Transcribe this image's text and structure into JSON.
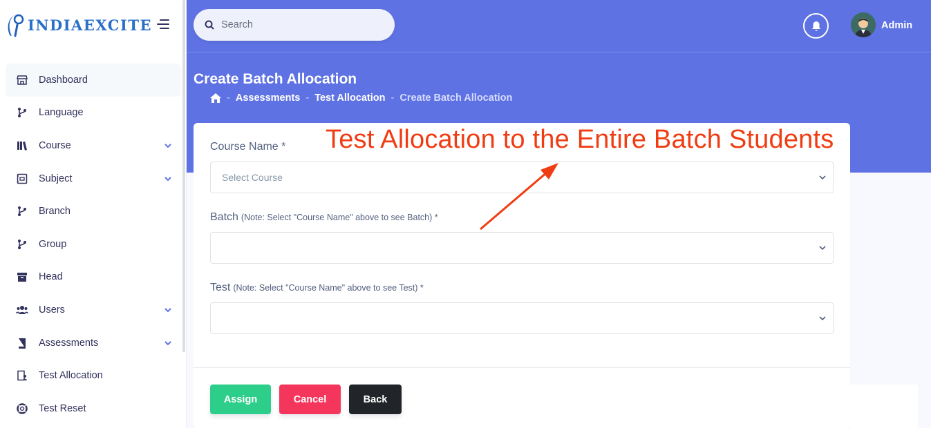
{
  "brand": {
    "name": "INDIAEXCITE",
    "color": "#2a6fc9"
  },
  "colors": {
    "header": "#5e72e4",
    "assign": "#2dce89",
    "cancel": "#f5365c",
    "back": "#212529",
    "annotation": "#f03c13"
  },
  "sidebar": {
    "items": [
      {
        "label": "Dashboard",
        "icon": "shop-icon",
        "active": true
      },
      {
        "label": "Language",
        "icon": "branch-icon"
      },
      {
        "label": "Course",
        "icon": "library-icon",
        "expandable": true
      },
      {
        "label": "Subject",
        "icon": "list-box-icon",
        "expandable": true
      },
      {
        "label": "Branch",
        "icon": "branch-icon"
      },
      {
        "label": "Group",
        "icon": "branch-icon"
      },
      {
        "label": "Head",
        "icon": "box-icon"
      },
      {
        "label": "Users",
        "icon": "users-icon",
        "expandable": true
      },
      {
        "label": "Assessments",
        "icon": "book-icon",
        "expandable": true
      },
      {
        "label": "Test Allocation",
        "icon": "assign-icon"
      },
      {
        "label": "Test Reset",
        "icon": "lifebuoy-icon"
      }
    ]
  },
  "header": {
    "search_placeholder": "Search",
    "user_name": "Admin"
  },
  "page": {
    "title": "Create Batch Allocation",
    "breadcrumb": [
      "Assessments",
      "Test Allocation",
      "Create Batch Allocation"
    ]
  },
  "form": {
    "course": {
      "label": "Course Name *",
      "placeholder": "Select Course"
    },
    "batch": {
      "label": "Batch",
      "note": "(Note: Select \"Course Name\" above to see Batch) *",
      "value": ""
    },
    "test": {
      "label": "Test",
      "note": "(Note: Select \"Course Name\" above to see Test) *",
      "value": ""
    }
  },
  "buttons": {
    "assign": "Assign",
    "cancel": "Cancel",
    "back": "Back"
  },
  "annotation": {
    "text": "Test Allocation to the Entire Batch Students"
  }
}
